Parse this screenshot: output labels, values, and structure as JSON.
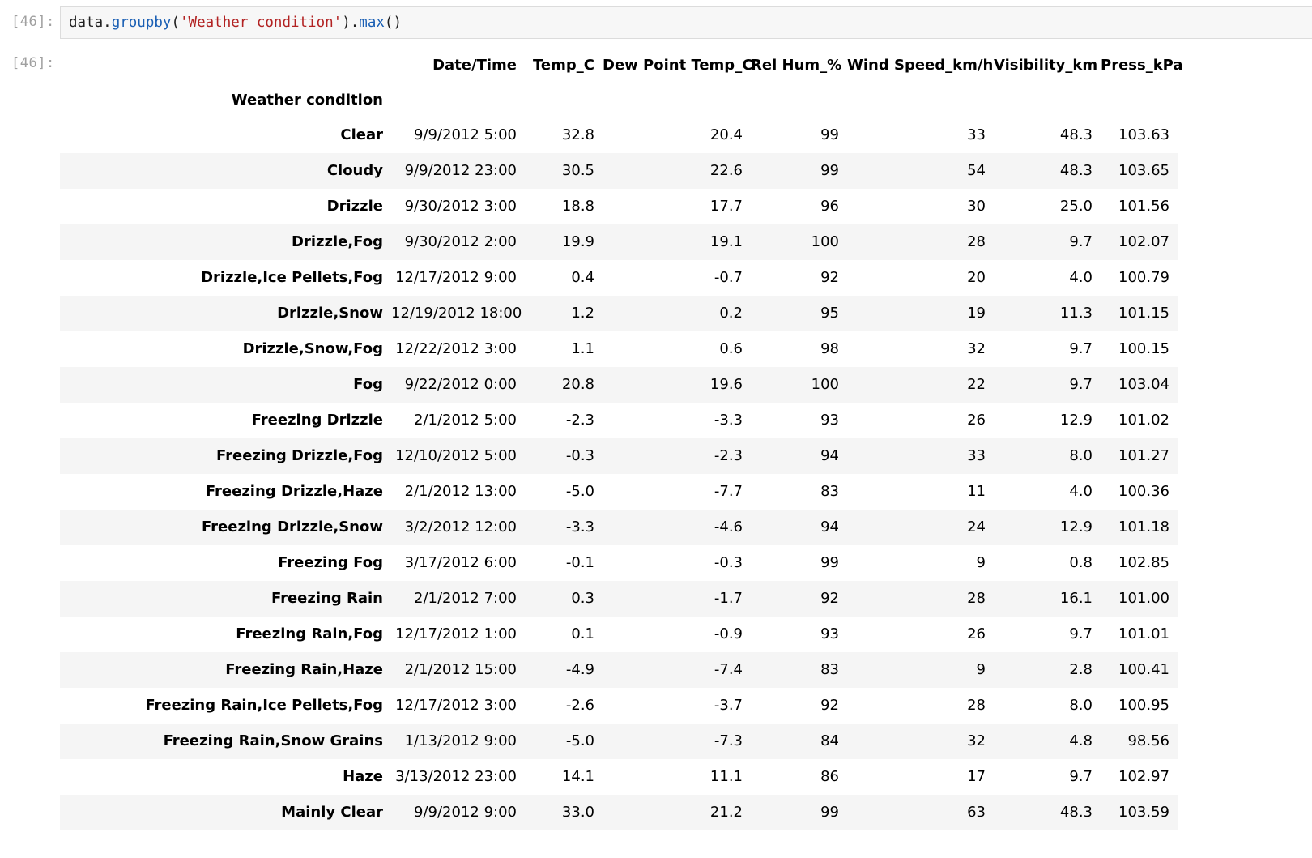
{
  "input": {
    "prompt": "[46]:",
    "code": {
      "obj": "data",
      "dot1": ".",
      "method1": "groupby",
      "open1": "(",
      "arg": "'Weather condition'",
      "close1": ")",
      "dot2": ".",
      "method2": "max",
      "call2": "()"
    }
  },
  "output": {
    "prompt": "[46]:",
    "index_name": "Weather condition",
    "columns": [
      "Date/Time",
      "Temp_C",
      "Dew Point Temp_C",
      "Rel Hum_%",
      "Wind Speed_km/h",
      "Visibility_km",
      "Press_kPa"
    ],
    "rows": [
      {
        "index": "Clear",
        "values": [
          "9/9/2012 5:00",
          "32.8",
          "20.4",
          "99",
          "33",
          "48.3",
          "103.63"
        ]
      },
      {
        "index": "Cloudy",
        "values": [
          "9/9/2012 23:00",
          "30.5",
          "22.6",
          "99",
          "54",
          "48.3",
          "103.65"
        ]
      },
      {
        "index": "Drizzle",
        "values": [
          "9/30/2012 3:00",
          "18.8",
          "17.7",
          "96",
          "30",
          "25.0",
          "101.56"
        ]
      },
      {
        "index": "Drizzle,Fog",
        "values": [
          "9/30/2012 2:00",
          "19.9",
          "19.1",
          "100",
          "28",
          "9.7",
          "102.07"
        ]
      },
      {
        "index": "Drizzle,Ice Pellets,Fog",
        "values": [
          "12/17/2012 9:00",
          "0.4",
          "-0.7",
          "92",
          "20",
          "4.0",
          "100.79"
        ]
      },
      {
        "index": "Drizzle,Snow",
        "values": [
          "12/19/2012 18:00",
          "1.2",
          "0.2",
          "95",
          "19",
          "11.3",
          "101.15"
        ]
      },
      {
        "index": "Drizzle,Snow,Fog",
        "values": [
          "12/22/2012 3:00",
          "1.1",
          "0.6",
          "98",
          "32",
          "9.7",
          "100.15"
        ]
      },
      {
        "index": "Fog",
        "values": [
          "9/22/2012 0:00",
          "20.8",
          "19.6",
          "100",
          "22",
          "9.7",
          "103.04"
        ]
      },
      {
        "index": "Freezing Drizzle",
        "values": [
          "2/1/2012 5:00",
          "-2.3",
          "-3.3",
          "93",
          "26",
          "12.9",
          "101.02"
        ]
      },
      {
        "index": "Freezing Drizzle,Fog",
        "values": [
          "12/10/2012 5:00",
          "-0.3",
          "-2.3",
          "94",
          "33",
          "8.0",
          "101.27"
        ]
      },
      {
        "index": "Freezing Drizzle,Haze",
        "values": [
          "2/1/2012 13:00",
          "-5.0",
          "-7.7",
          "83",
          "11",
          "4.0",
          "100.36"
        ]
      },
      {
        "index": "Freezing Drizzle,Snow",
        "values": [
          "3/2/2012 12:00",
          "-3.3",
          "-4.6",
          "94",
          "24",
          "12.9",
          "101.18"
        ]
      },
      {
        "index": "Freezing Fog",
        "values": [
          "3/17/2012 6:00",
          "-0.1",
          "-0.3",
          "99",
          "9",
          "0.8",
          "102.85"
        ]
      },
      {
        "index": "Freezing Rain",
        "values": [
          "2/1/2012 7:00",
          "0.3",
          "-1.7",
          "92",
          "28",
          "16.1",
          "101.00"
        ]
      },
      {
        "index": "Freezing Rain,Fog",
        "values": [
          "12/17/2012 1:00",
          "0.1",
          "-0.9",
          "93",
          "26",
          "9.7",
          "101.01"
        ]
      },
      {
        "index": "Freezing Rain,Haze",
        "values": [
          "2/1/2012 15:00",
          "-4.9",
          "-7.4",
          "83",
          "9",
          "2.8",
          "100.41"
        ]
      },
      {
        "index": "Freezing Rain,Ice Pellets,Fog",
        "values": [
          "12/17/2012 3:00",
          "-2.6",
          "-3.7",
          "92",
          "28",
          "8.0",
          "100.95"
        ]
      },
      {
        "index": "Freezing Rain,Snow Grains",
        "values": [
          "1/13/2012 9:00",
          "-5.0",
          "-7.3",
          "84",
          "32",
          "4.8",
          "98.56"
        ]
      },
      {
        "index": "Haze",
        "values": [
          "3/13/2012 23:00",
          "14.1",
          "11.1",
          "86",
          "17",
          "9.7",
          "102.97"
        ]
      },
      {
        "index": "Mainly Clear",
        "values": [
          "9/9/2012 9:00",
          "33.0",
          "21.2",
          "99",
          "63",
          "48.3",
          "103.59"
        ]
      }
    ]
  }
}
